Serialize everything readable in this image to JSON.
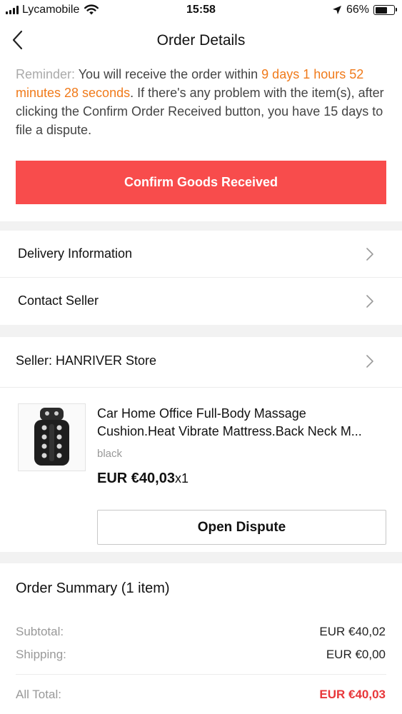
{
  "status_bar": {
    "carrier": "Lycamobile",
    "time": "15:58",
    "battery_percent": "66%",
    "battery_level": 0.66,
    "icons": [
      "signal-icon",
      "wifi-icon",
      "location-icon",
      "battery-icon"
    ]
  },
  "nav": {
    "title": "Order Details",
    "back_icon": "chevron-left-icon"
  },
  "reminder": {
    "label": "Reminder:",
    "text_before": " You will receive the order within ",
    "countdown": "9 days 1 hours 52 minutes 28 seconds",
    "text_after": ". If there's any problem with the item(s), after clicking the Confirm Order Received button, you have 15 days to file a dispute.",
    "confirm_button": "Confirm Goods Received"
  },
  "links": {
    "delivery": "Delivery Information",
    "contact": "Contact Seller",
    "seller": "Seller: HANRIVER Store"
  },
  "product": {
    "title_line1": "Car Home Office Full-Body Massage",
    "title_line2": "Cushion.Heat Vibrate Mattress.Back Neck M...",
    "variant": "black",
    "price": "EUR €40,03",
    "quantity": "x1",
    "dispute_button": "Open Dispute"
  },
  "summary": {
    "title": "Order Summary (1 item)",
    "subtotal_label": "Subtotal:",
    "subtotal_value": "EUR €40,02",
    "shipping_label": "Shipping:",
    "shipping_value": "EUR €0,00",
    "total_label": "All Total:",
    "total_value": "EUR €40,03"
  },
  "colors": {
    "accent_red": "#f84c4c",
    "countdown_orange": "#f07a1a",
    "total_red": "#e8373a"
  }
}
